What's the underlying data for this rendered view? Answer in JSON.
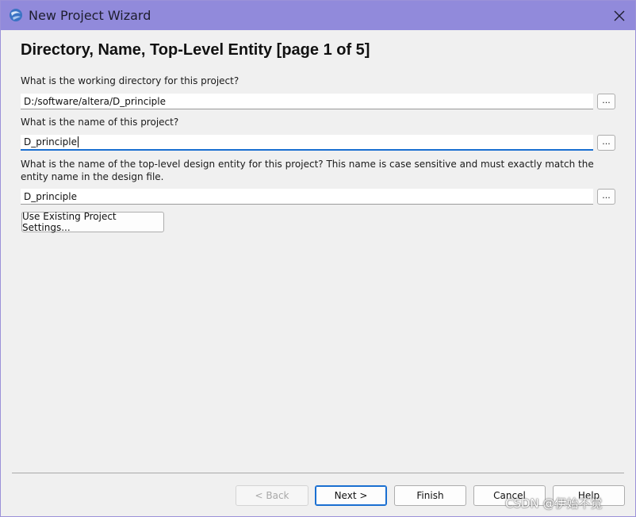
{
  "window": {
    "title": "New Project Wizard",
    "icon": "quartus-app-icon",
    "close_icon": "close-icon"
  },
  "page": {
    "heading": "Directory, Name, Top-Level Entity [page 1 of 5]"
  },
  "fields": {
    "directory": {
      "label": "What is the working directory for this project?",
      "value": "D:/software/altera/D_principle",
      "browse_label": "..."
    },
    "project_name": {
      "label": "What is the name of this project?",
      "value": "D_principle",
      "browse_label": "..."
    },
    "top_entity": {
      "label": "What is the name of the top-level design entity for this project? This name is case sensitive and must exactly match the entity name in the design file.",
      "value": "D_principle",
      "browse_label": "..."
    }
  },
  "buttons": {
    "existing_settings": "Use Existing Project Settings...",
    "back": "< Back",
    "next": "Next >",
    "finish": "Finish",
    "cancel": "Cancel",
    "help": "Help"
  },
  "watermark": "CSDN @伊始不觉"
}
